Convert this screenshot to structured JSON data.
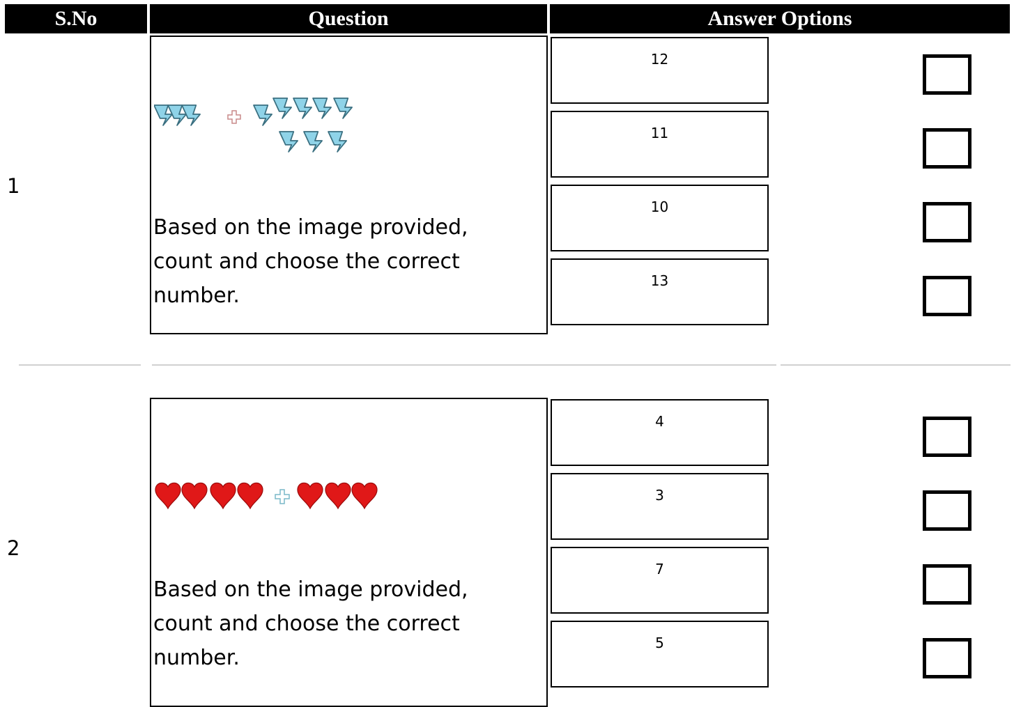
{
  "header": {
    "sno": "S.No",
    "question": "Question",
    "answer_options": "Answer Options"
  },
  "questions": [
    {
      "sno": "1",
      "image": {
        "left_count": 3,
        "operator": "plus",
        "right_row1": 5,
        "right_row2": 3,
        "item": "lightning-bolt"
      },
      "text": "Based on the image provided, count and choose the correct number.",
      "options": [
        "12",
        "11",
        "10",
        "13"
      ]
    },
    {
      "sno": "2",
      "image": {
        "left_count": 4,
        "operator": "plus",
        "right_count": 3,
        "item": "heart"
      },
      "text": "Based on the image provided, count and choose the correct number.",
      "options": [
        "4",
        "3",
        "7",
        "5"
      ]
    }
  ],
  "colors": {
    "header_bg": "#000000",
    "header_text": "#ffffff",
    "bolt_fill": "#8fd3e8",
    "bolt_stroke": "#3a6f80",
    "heart_fill": "#e01818",
    "plus_q1": "#c98a8a",
    "plus_q2": "#7ab8c8"
  }
}
